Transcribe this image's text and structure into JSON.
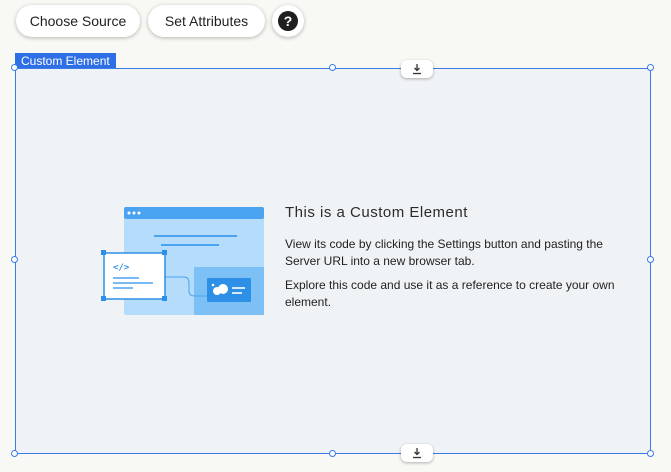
{
  "toolbar": {
    "choose_source_label": "Choose Source",
    "set_attributes_label": "Set Attributes",
    "help_label": "?"
  },
  "element": {
    "tag_label": "Custom Element",
    "title": "This is a Custom Element",
    "paragraph1": "View its code by clicking the Settings button and pasting the Server URL into a new browser tab.",
    "paragraph2": "Explore this code and use it as a reference to create your own element.",
    "illustration_code_glyph": "</>"
  },
  "colors": {
    "selection_blue": "#3b7be8",
    "tag_blue": "#2f6fe6",
    "illustration_light": "#b5dcfb",
    "illustration_mid": "#4aa3f0"
  },
  "icons": {
    "anchor_top": "arrow-down-to-line-icon",
    "anchor_bottom": "arrow-down-to-line-icon",
    "help": "question-circle-icon"
  }
}
